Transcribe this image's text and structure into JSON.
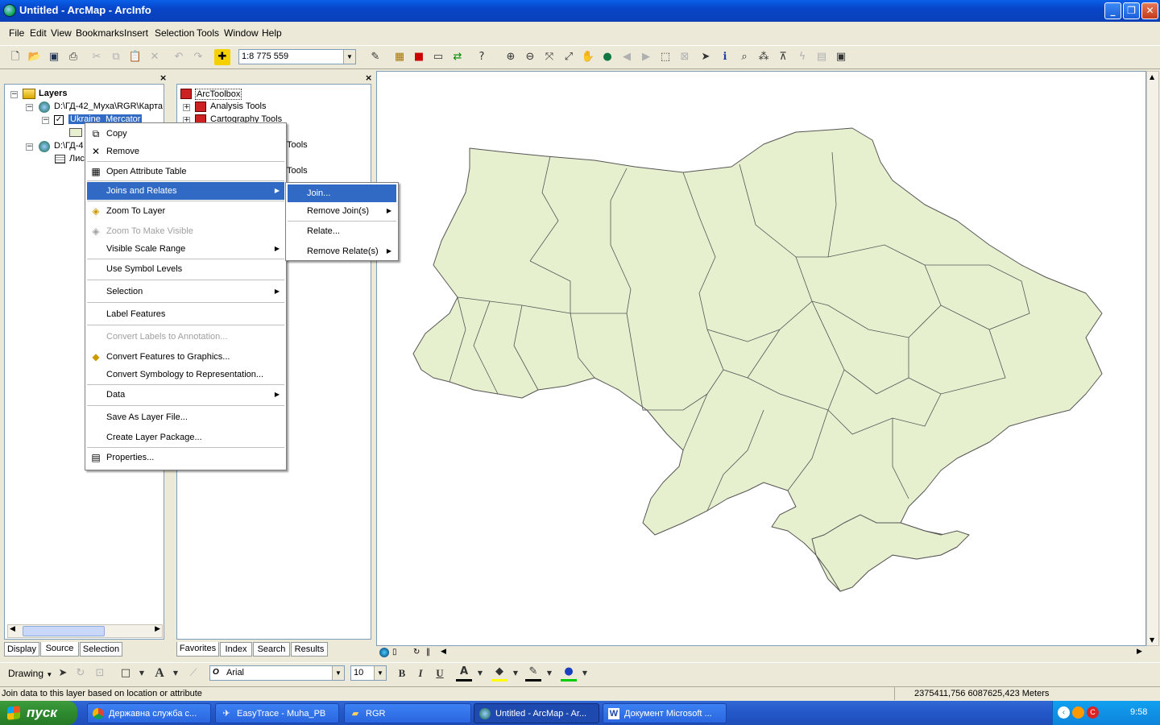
{
  "window": {
    "title": "Untitled - ArcMap - ArcInfo",
    "buttons": [
      "_",
      "❐",
      "✕"
    ]
  },
  "menubar": [
    "File",
    "Edit",
    "View",
    "Bookmarks",
    "Insert",
    "Selection",
    "Tools",
    "Window",
    "Help"
  ],
  "toolbar": {
    "scale": "1:8 775 559"
  },
  "toc": {
    "root": "Layers",
    "frame1": "D:\\ГД-42_Муха\\RGR\\Карта",
    "layer_selected": "Ukraine_Mercator",
    "frame2": "D:\\ГД-4",
    "table": "Лис",
    "tabs": [
      "Display",
      "Source",
      "Selection"
    ],
    "active_tab": "Source"
  },
  "toolbox": {
    "root": "ArcToolbox",
    "items": [
      "Analysis Tools",
      "Cartography Tools",
      "Tools",
      "Tools"
    ],
    "tabs": [
      "Favorites",
      "Index",
      "Search",
      "Results"
    ],
    "active_tab": "Favorites"
  },
  "context_menu": {
    "copy": "Copy",
    "remove": "Remove",
    "open_attr": "Open Attribute Table",
    "joins": "Joins and Relates",
    "zoom_layer": "Zoom To Layer",
    "zoom_visible": "Zoom To Make Visible",
    "visible_range": "Visible Scale Range",
    "symbol_levels": "Use Symbol Levels",
    "selection": "Selection",
    "label_features": "Label Features",
    "convert_labels": "Convert Labels to Annotation...",
    "convert_features": "Convert Features to Graphics...",
    "convert_symbology": "Convert Symbology to Representation...",
    "data": "Data",
    "save_layer": "Save As Layer File...",
    "create_package": "Create Layer Package...",
    "properties": "Properties..."
  },
  "submenu": {
    "join": "Join...",
    "remove_join": "Remove Join(s)",
    "relate": "Relate...",
    "remove_relate": "Remove Relate(s)"
  },
  "drawbar": {
    "drawing": "Drawing",
    "font": "Arial",
    "size": "10",
    "bold": "B",
    "italic": "I",
    "underline": "U"
  },
  "status": {
    "message": "Join data to this layer based on location or attribute",
    "coords": "2375411,756  6087625,423 Meters"
  },
  "taskbar": {
    "start": "пуск",
    "tasks": [
      "Державна служба с...",
      "EasyTrace - Muha_PB",
      "RGR",
      "Untitled - ArcMap - Ar...",
      "Документ Microsoft ..."
    ],
    "lang": "EN",
    "clock": "9:58"
  },
  "colors": {
    "map_fill": "#e6f0cf",
    "map_stroke": "#555555",
    "highlight": "#316ac5"
  }
}
